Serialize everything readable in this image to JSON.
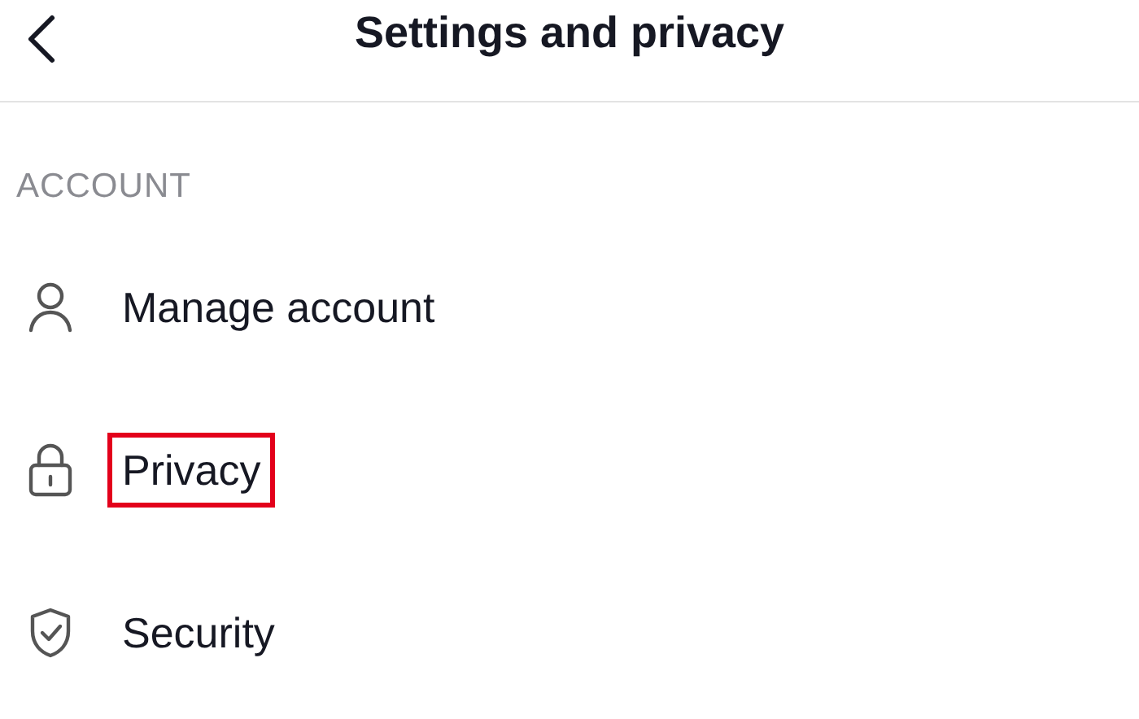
{
  "header": {
    "title": "Settings and privacy"
  },
  "section": {
    "title": "ACCOUNT",
    "items": [
      {
        "label": "Manage account",
        "kind": "person",
        "highlighted": false
      },
      {
        "label": "Privacy",
        "kind": "lock",
        "highlighted": true
      },
      {
        "label": "Security",
        "kind": "shield",
        "highlighted": false
      }
    ]
  }
}
